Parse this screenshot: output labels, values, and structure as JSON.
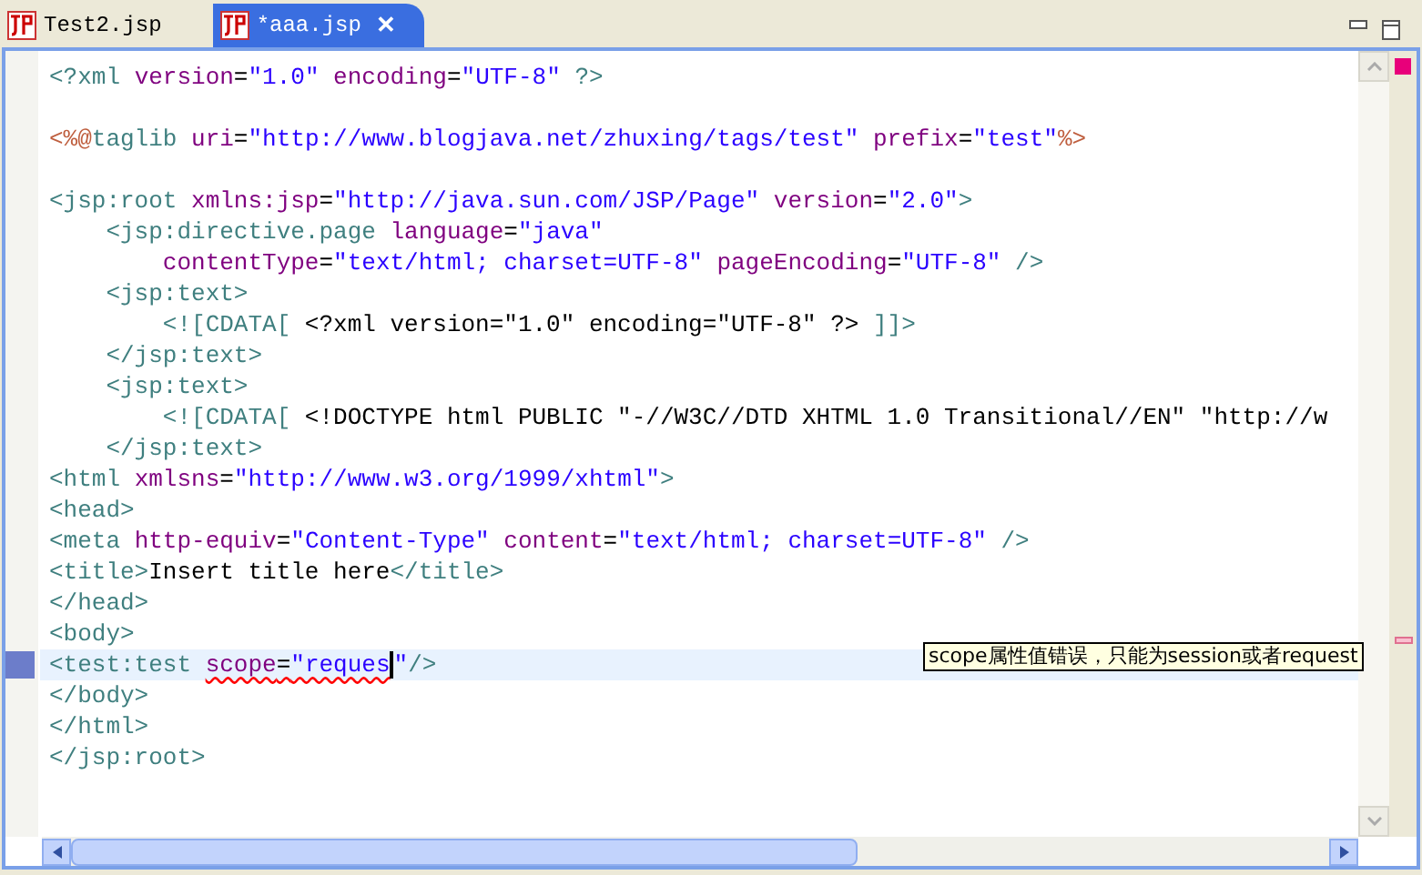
{
  "tabs": [
    {
      "label": "Test2.jsp",
      "selected": false,
      "closable": false
    },
    {
      "label": "*aaa.jsp",
      "selected": true,
      "closable": true,
      "close_glyph": "✕"
    }
  ],
  "editor": {
    "lines": [
      {
        "current": false,
        "annotation": false,
        "tokens": [
          {
            "kind": "tag",
            "text": "<?xml "
          },
          {
            "kind": "attr",
            "text": "version"
          },
          {
            "kind": "text",
            "text": "="
          },
          {
            "kind": "value",
            "text": "\"1.0\" "
          },
          {
            "kind": "attr",
            "text": "encoding"
          },
          {
            "kind": "text",
            "text": "="
          },
          {
            "kind": "value",
            "text": "\"UTF-8\""
          },
          {
            "kind": "tag",
            "text": " ?>"
          }
        ]
      },
      {
        "current": false,
        "annotation": false
      },
      {
        "current": false,
        "annotation": false,
        "tokens": [
          {
            "kind": "directive",
            "text": "<%@"
          },
          {
            "kind": "tag",
            "text": "taglib "
          },
          {
            "kind": "attr",
            "text": "uri"
          },
          {
            "kind": "text",
            "text": "="
          },
          {
            "kind": "value",
            "text": "\"http://www.blogjava.net/zhuxing/tags/test\" "
          },
          {
            "kind": "attr",
            "text": "prefix"
          },
          {
            "kind": "text",
            "text": "="
          },
          {
            "kind": "value",
            "text": "\"test\""
          },
          {
            "kind": "directive",
            "text": "%>"
          }
        ]
      },
      {
        "current": false,
        "annotation": false
      },
      {
        "current": false,
        "annotation": false,
        "tokens": [
          {
            "kind": "tag",
            "text": "<jsp:root "
          },
          {
            "kind": "attr",
            "text": "xmlns:jsp"
          },
          {
            "kind": "text",
            "text": "="
          },
          {
            "kind": "value",
            "text": "\"http://java.sun.com/JSP/Page\" "
          },
          {
            "kind": "attr",
            "text": "version"
          },
          {
            "kind": "text",
            "text": "="
          },
          {
            "kind": "value",
            "text": "\"2.0\""
          },
          {
            "kind": "tag",
            "text": ">"
          }
        ]
      },
      {
        "current": false,
        "annotation": false,
        "tokens": [
          {
            "kind": "tag",
            "text": "    <jsp:directive.page "
          },
          {
            "kind": "attr",
            "text": "language"
          },
          {
            "kind": "text",
            "text": "="
          },
          {
            "kind": "value",
            "text": "\"java\""
          }
        ]
      },
      {
        "current": false,
        "annotation": false,
        "tokens": [
          {
            "kind": "attr",
            "text": "        contentType"
          },
          {
            "kind": "text",
            "text": "="
          },
          {
            "kind": "value",
            "text": "\"text/html; charset=UTF-8\" "
          },
          {
            "kind": "attr",
            "text": "pageEncoding"
          },
          {
            "kind": "text",
            "text": "="
          },
          {
            "kind": "value",
            "text": "\"UTF-8\""
          },
          {
            "kind": "tag",
            "text": " />"
          }
        ]
      },
      {
        "current": false,
        "annotation": false,
        "tokens": [
          {
            "kind": "tag",
            "text": "    <jsp:text>"
          }
        ]
      },
      {
        "current": false,
        "annotation": false,
        "tokens": [
          {
            "kind": "tag",
            "text": "        <![CDATA["
          },
          {
            "kind": "text",
            "text": " <?xml version=\"1.0\" encoding=\"UTF-8\" ?> "
          },
          {
            "kind": "tag",
            "text": "]]>"
          }
        ]
      },
      {
        "current": false,
        "annotation": false,
        "tokens": [
          {
            "kind": "tag",
            "text": "    </jsp:text>"
          }
        ]
      },
      {
        "current": false,
        "annotation": false,
        "tokens": [
          {
            "kind": "tag",
            "text": "    <jsp:text>"
          }
        ]
      },
      {
        "current": false,
        "annotation": false,
        "tokens": [
          {
            "kind": "tag",
            "text": "        <![CDATA["
          },
          {
            "kind": "text",
            "text": " <!DOCTYPE html PUBLIC \"-//W3C//DTD XHTML 1.0 Transitional//EN\" \"http://w"
          }
        ]
      },
      {
        "current": false,
        "annotation": false,
        "tokens": [
          {
            "kind": "tag",
            "text": "    </jsp:text>"
          }
        ]
      },
      {
        "current": false,
        "annotation": false,
        "tokens": [
          {
            "kind": "tag",
            "text": "<html "
          },
          {
            "kind": "attr",
            "text": "xmlsns"
          },
          {
            "kind": "text",
            "text": "="
          },
          {
            "kind": "value",
            "text": "\"http://www.w3.org/1999/xhtml\""
          },
          {
            "kind": "tag",
            "text": ">"
          }
        ]
      },
      {
        "current": false,
        "annotation": false,
        "tokens": [
          {
            "kind": "tag",
            "text": "<head>"
          }
        ]
      },
      {
        "current": false,
        "annotation": false,
        "tokens": [
          {
            "kind": "tag",
            "text": "<meta "
          },
          {
            "kind": "attr",
            "text": "http-equiv"
          },
          {
            "kind": "text",
            "text": "="
          },
          {
            "kind": "value",
            "text": "\"Content-Type\" "
          },
          {
            "kind": "attr",
            "text": "content"
          },
          {
            "kind": "text",
            "text": "="
          },
          {
            "kind": "value",
            "text": "\"text/html; charset=UTF-8\""
          },
          {
            "kind": "tag",
            "text": " />"
          }
        ]
      },
      {
        "current": false,
        "annotation": false,
        "tokens": [
          {
            "kind": "tag",
            "text": "<title>"
          },
          {
            "kind": "text",
            "text": "Insert title here"
          },
          {
            "kind": "tag",
            "text": "</title>"
          }
        ]
      },
      {
        "current": false,
        "annotation": false,
        "tokens": [
          {
            "kind": "tag",
            "text": "</head>"
          }
        ]
      },
      {
        "current": false,
        "annotation": false,
        "tokens": [
          {
            "kind": "tag",
            "text": "<body>"
          }
        ]
      },
      {
        "current": true,
        "annotation": true,
        "tokens": [
          {
            "kind": "tag",
            "text": "<test:test "
          },
          {
            "kind": "attr",
            "text": "scope",
            "error": true
          },
          {
            "kind": "text",
            "text": "=",
            "error": true
          },
          {
            "kind": "value",
            "text": "\"reques",
            "error": true
          },
          {
            "kind": "caret"
          },
          {
            "kind": "value",
            "text": "\""
          },
          {
            "kind": "tag",
            "text": "/>"
          }
        ]
      },
      {
        "current": false,
        "annotation": false,
        "tokens": [
          {
            "kind": "tag",
            "text": "</body>"
          }
        ]
      },
      {
        "current": false,
        "annotation": false,
        "tokens": [
          {
            "kind": "tag",
            "text": "</html>"
          }
        ]
      },
      {
        "current": false,
        "annotation": false,
        "tokens": [
          {
            "kind": "tag",
            "text": "</jsp:root>"
          }
        ]
      }
    ],
    "tooltip": "scope属性值错误，只能为session或者request"
  }
}
